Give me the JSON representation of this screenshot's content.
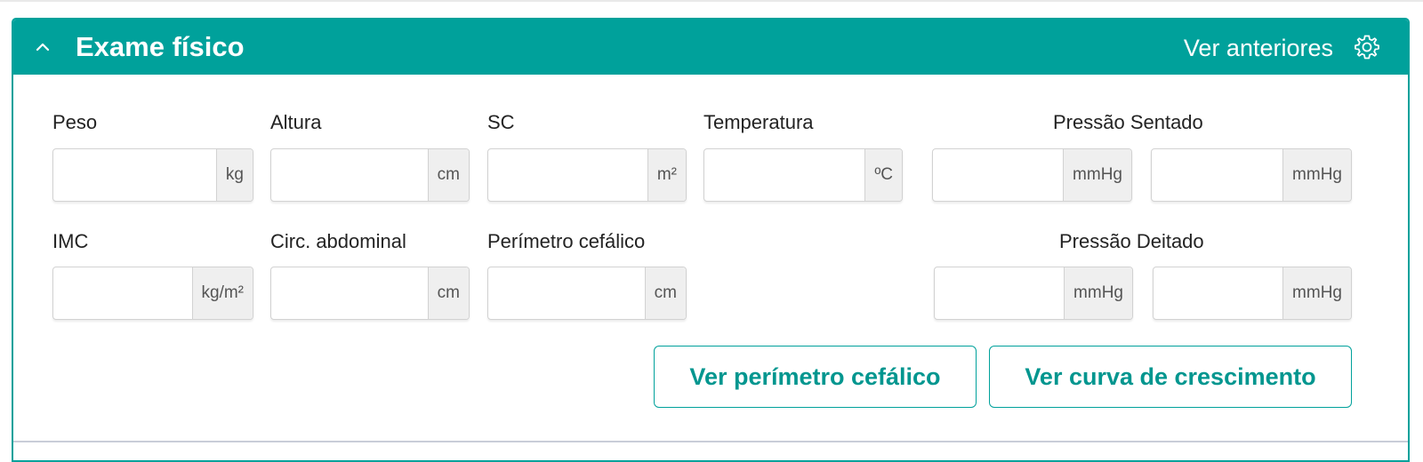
{
  "section": {
    "title": "Exame físico",
    "previous_link": "Ver anteriores",
    "collapse_icon": "chevron-up-icon",
    "settings_icon": "gear-icon",
    "accent_color": "#00a19b"
  },
  "fields": {
    "peso": {
      "label": "Peso",
      "unit": "kg",
      "value": "",
      "placeholder": ""
    },
    "altura": {
      "label": "Altura",
      "unit": "cm",
      "value": "",
      "placeholder": ""
    },
    "sc": {
      "label": "SC",
      "unit": "m²",
      "value": "",
      "placeholder": ""
    },
    "temperatura": {
      "label": "Temperatura",
      "unit": "ºC",
      "value": "",
      "placeholder": ""
    },
    "pressao_sentado": {
      "label": "Pressão Sentado",
      "unit_1": "mmHg",
      "unit_2": "mmHg"
    },
    "imc": {
      "label": "IMC",
      "unit": "kg/m²",
      "value": "",
      "placeholder": ""
    },
    "circ_abdominal": {
      "label": "Circ. abdominal",
      "unit": "cm",
      "value": "",
      "placeholder": ""
    },
    "perimetro_cefalico": {
      "label": "Perímetro cefálico",
      "unit": "cm",
      "value": "",
      "placeholder": ""
    },
    "pressao_deitado": {
      "label": "Pressão Deitado",
      "unit_1": "mmHg",
      "unit_2": "mmHg"
    }
  },
  "buttons": {
    "perimetro": "Ver perímetro cefálico",
    "curva": "Ver curva de crescimento"
  }
}
